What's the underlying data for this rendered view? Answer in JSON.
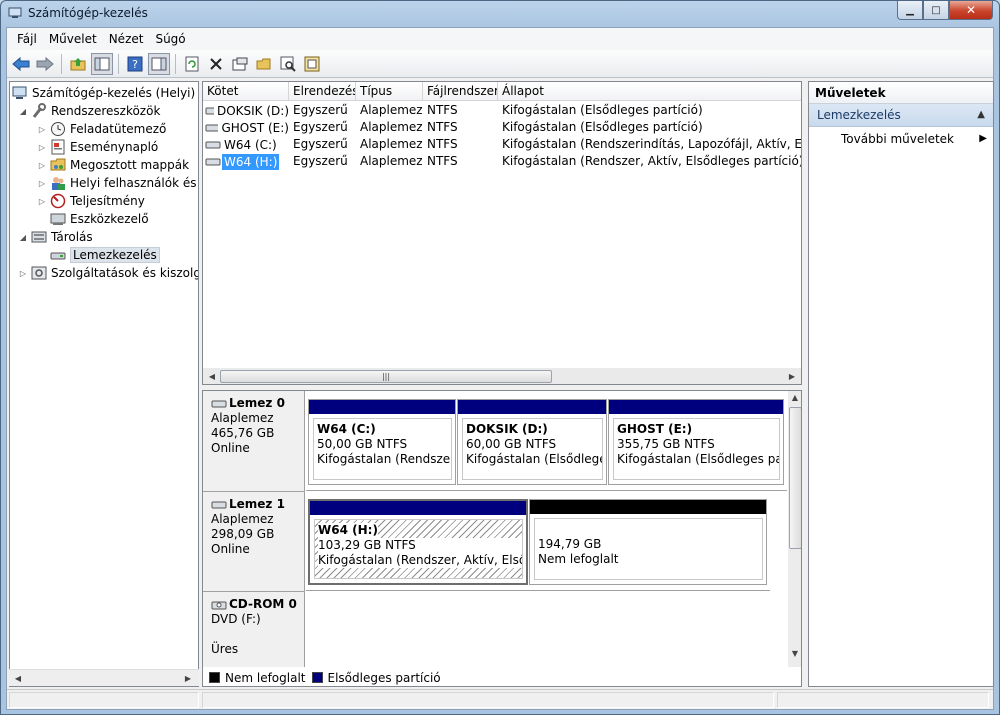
{
  "window": {
    "title": "Számítógép-kezelés"
  },
  "menu": [
    "Fájl",
    "Művelet",
    "Nézet",
    "Súgó"
  ],
  "toolbar_icons": [
    "back-arrow-icon",
    "forward-arrow-icon",
    "up-folder-icon",
    "show-tree-icon",
    "help-icon",
    "properties-pane-icon",
    "refresh-icon",
    "delete-icon",
    "properties-icon",
    "open-folder-icon",
    "search-icon",
    "rescan-disks-icon"
  ],
  "tree": {
    "root": "Számítógép-kezelés (Helyi)",
    "system_tools": "Rendszereszközök",
    "task_scheduler": "Feladatütemező",
    "event_viewer": "Eseménynapló",
    "shared_folders": "Megosztott mappák",
    "local_users": "Helyi felhasználók és cs",
    "performance": "Teljesítmény",
    "device_manager": "Eszközkezelő",
    "storage": "Tárolás",
    "disk_management": "Lemezkezelés",
    "services": "Szolgáltatások és kiszolgáló"
  },
  "volume_list": {
    "columns": [
      "Kötet",
      "Elrendezés",
      "Típus",
      "Fájlrendszer",
      "Állapot"
    ],
    "rows": [
      [
        "DOKSIK (D:)",
        "Egyszerű",
        "Alaplemez",
        "NTFS",
        "Kifogástalan (Elsődleges partíció)"
      ],
      [
        "GHOST (E:)",
        "Egyszerű",
        "Alaplemez",
        "NTFS",
        "Kifogástalan (Elsődleges partíció)"
      ],
      [
        "W64 (C:)",
        "Egyszerű",
        "Alaplemez",
        "NTFS",
        "Kifogástalan (Rendszerindítás, Lapozófájl, Aktív, Elsődlege"
      ],
      [
        "W64 (H:)",
        "Egyszerű",
        "Alaplemez",
        "NTFS",
        "Kifogástalan (Rendszer, Aktív, Elsődleges partíció)"
      ]
    ]
  },
  "disks": {
    "disk0": {
      "name": "Lemez 0",
      "type": "Alaplemez",
      "size": "465,76 GB",
      "state": "Online",
      "partitions": [
        {
          "name": "W64  (C:)",
          "size": "50,00 GB NTFS",
          "status": "Kifogástalan (Rendszerinc"
        },
        {
          "name": "DOKSIK  (D:)",
          "size": "60,00 GB NTFS",
          "status": "Kifogástalan (Elsődleges p"
        },
        {
          "name": "GHOST  (E:)",
          "size": "355,75 GB NTFS",
          "status": "Kifogástalan (Elsődleges partíc"
        }
      ]
    },
    "disk1": {
      "name": "Lemez 1",
      "type": "Alaplemez",
      "size": "298,09 GB",
      "state": "Online",
      "partitions": [
        {
          "name": "W64  (H:)",
          "size": "103,29 GB NTFS",
          "status": "Kifogástalan (Rendszer, Aktív, Elsődlege"
        },
        {
          "size": "194,79 GB",
          "status": "Nem lefoglalt"
        }
      ]
    },
    "cdrom0": {
      "name": "CD-ROM 0",
      "drive": "DVD (F:)",
      "state": "Üres"
    }
  },
  "legend": {
    "unallocated": "Nem lefoglalt",
    "primary": "Elsődleges partíció"
  },
  "colors": {
    "primary": "#00007f",
    "unallocated": "#000000"
  },
  "actions": {
    "header": "Műveletek",
    "section": "Lemezkezelés",
    "more": "További műveletek"
  }
}
